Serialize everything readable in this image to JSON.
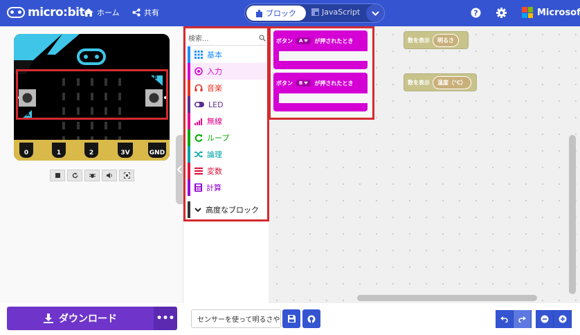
{
  "header": {
    "logo_text": "micro:bit",
    "home_label": "ホーム",
    "share_label": "共有",
    "tab_blocks": "ブロック",
    "tab_javascript": "JavaScript",
    "brand": "Microsoft"
  },
  "simulator": {
    "button_a": "A",
    "button_b": "B",
    "pins": [
      "0",
      "1",
      "2",
      "3V",
      "GND"
    ]
  },
  "toolbox": {
    "search_placeholder": "検索...",
    "categories": [
      {
        "label": "基本",
        "color": "#1e90ff",
        "icon": "grid-icon"
      },
      {
        "label": "入力",
        "color": "#d400d4",
        "icon": "target-icon"
      },
      {
        "label": "音楽",
        "color": "#e63022",
        "icon": "headphones-icon"
      },
      {
        "label": "LED",
        "color": "#5c2d91",
        "icon": "toggle-icon"
      },
      {
        "label": "無線",
        "color": "#e3008c",
        "icon": "signal-icon"
      },
      {
        "label": "ループ",
        "color": "#00aa00",
        "icon": "loop-icon"
      },
      {
        "label": "論理",
        "color": "#00a4a6",
        "icon": "shuffle-icon"
      },
      {
        "label": "変数",
        "color": "#dc143c",
        "icon": "list-icon"
      },
      {
        "label": "計算",
        "color": "#9400d3",
        "icon": "calculator-icon"
      }
    ],
    "advanced_label": "高度なブロック"
  },
  "flyout": {
    "block_a": {
      "prefix": "ボタン",
      "button": "A",
      "suffix": "が押されたとき"
    },
    "block_b": {
      "prefix": "ボタン",
      "button": "B",
      "suffix": "が押されたとき"
    }
  },
  "workspace": {
    "show_block_1": {
      "label": "数を表示",
      "value": "明るさ"
    },
    "show_block_2": {
      "label": "数を表示",
      "value": "温度（℃）"
    }
  },
  "footer": {
    "download_label": "ダウンロード",
    "more_label": "•••",
    "project_name": "センサーを使って明るさや"
  },
  "colors": {
    "brand_blue": "#3454d1",
    "download_purple": "#6f35ca",
    "input_magenta": "#d400d4",
    "highlight_red": "#d52a30"
  }
}
